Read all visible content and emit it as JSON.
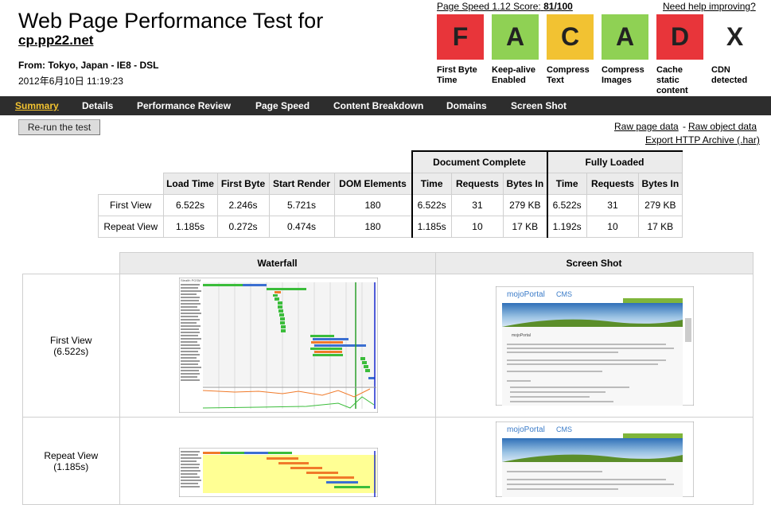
{
  "header": {
    "title": "Web Page Performance Test for",
    "site": "cp.pp22.net",
    "from": "From: Tokyo, Japan - IE8 - DSL",
    "date": "2012年6月10日 11:19:23",
    "page_speed_label": "Page Speed 1.12 Score:",
    "page_speed_score": "81/100",
    "help_link": "Need help improving?"
  },
  "grades": [
    {
      "letter": "F",
      "label1": "First Byte",
      "label2": "Time",
      "label3": "",
      "color": "#e8353a"
    },
    {
      "letter": "A",
      "label1": "Keep-alive",
      "label2": "Enabled",
      "label3": "",
      "color": "#8fd154"
    },
    {
      "letter": "C",
      "label1": "Compress",
      "label2": "Text",
      "label3": "",
      "color": "#f2c232"
    },
    {
      "letter": "A",
      "label1": "Compress",
      "label2": "Images",
      "label3": "",
      "color": "#8fd154"
    },
    {
      "letter": "D",
      "label1": "Cache",
      "label2": "static",
      "label3": "content",
      "color": "#e8353a"
    },
    {
      "letter": "X",
      "label1": "CDN",
      "label2": "detected",
      "label3": "",
      "color": "#ffffff"
    }
  ],
  "nav": [
    "Summary",
    "Details",
    "Performance Review",
    "Page Speed",
    "Content Breakdown",
    "Domains",
    "Screen Shot"
  ],
  "actions": {
    "rerun": "Re-run the test",
    "raw_page": "Raw page data",
    "sep": "-",
    "raw_object": "Raw object data",
    "export_har": "Export HTTP Archive (.har)"
  },
  "results": {
    "group_doc": "Document Complete",
    "group_full": "Fully Loaded",
    "headers": [
      "Load Time",
      "First Byte",
      "Start Render",
      "DOM Elements",
      "Time",
      "Requests",
      "Bytes In",
      "Time",
      "Requests",
      "Bytes In"
    ],
    "rows": [
      {
        "label": "First View",
        "cells": [
          "6.522s",
          "2.246s",
          "5.721s",
          "180",
          "6.522s",
          "31",
          "279 KB",
          "6.522s",
          "31",
          "279 KB"
        ]
      },
      {
        "label": "Repeat View",
        "cells": [
          "1.185s",
          "0.272s",
          "0.474s",
          "180",
          "1.185s",
          "10",
          "17 KB",
          "1.192s",
          "10",
          "17 KB"
        ]
      }
    ]
  },
  "waterfall": {
    "col_waterfall": "Waterfall",
    "col_screenshot": "Screen Shot",
    "first_label": "First View",
    "first_time": "(6.522s)",
    "repeat_label": "Repeat View",
    "repeat_time": "(1.185s)",
    "thumb_header": "Stealth PGSM",
    "cms_brand": "mojoPortal",
    "cms_suffix": "CMS",
    "cms_heading": "mojoPortal"
  },
  "colors": {
    "nav_bg": "#2d2d2d",
    "nav_active": "#f4c430",
    "wf_green": "#3bbd3b",
    "wf_blue": "#3b6fd1",
    "wf_orange": "#f07a2a",
    "cms_header": "#7fb53a"
  }
}
